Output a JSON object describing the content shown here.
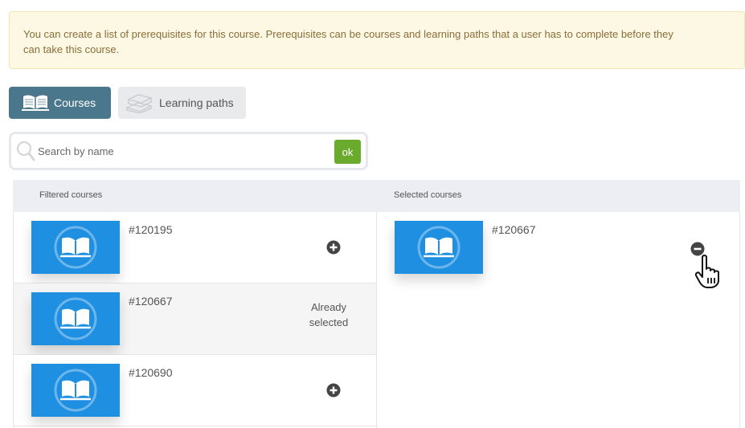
{
  "notice": {
    "line1": "You can create a list of prerequisites for this course. Prerequisites can be courses and learning paths that a user has to complete before they",
    "line2": "can take this course."
  },
  "tabs": [
    {
      "label": "Courses",
      "icon": "open-book-icon",
      "active": true
    },
    {
      "label": "Learning paths",
      "icon": "stacked-books-icon",
      "active": false
    }
  ],
  "search": {
    "placeholder": "Search by name",
    "value": "",
    "button_label": "ok"
  },
  "filtered": {
    "title": "Filtered courses",
    "rows": [
      {
        "id": "#120195",
        "status": "add"
      },
      {
        "id": "#120667",
        "status": "selected",
        "status_label_1": "Already",
        "status_label_2": "selected"
      },
      {
        "id": "#120690",
        "status": "add"
      }
    ]
  },
  "selected": {
    "title": "Selected courses",
    "rows": [
      {
        "id": "#120667"
      }
    ]
  },
  "colors": {
    "active_tab": "#4b778d",
    "inactive_tab": "#e9eaec",
    "ok_button": "#6aab2e",
    "thumbnail": "#1e8fe1",
    "notice_bg": "#fcf8e3",
    "notice_text": "#8a6d3b"
  }
}
